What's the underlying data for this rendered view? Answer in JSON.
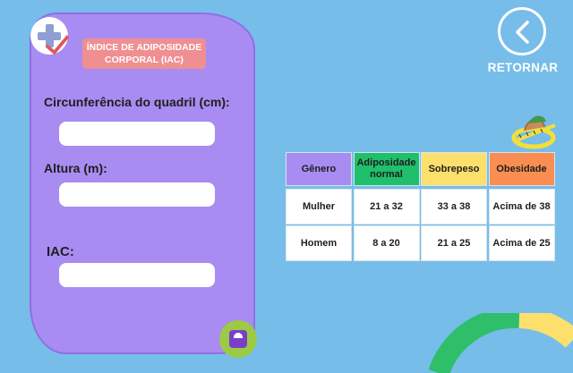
{
  "title_badge": "ÍNDICE DE ADIPOSIDADE CORPORAL (IAC)",
  "form": {
    "hip_label": "Circunferência do quadril (cm):",
    "hip_value": "",
    "height_label": "Altura (m):",
    "height_value": "",
    "iac_label": "IAC:",
    "iac_value": ""
  },
  "nav": {
    "back_label": "RETORNAR"
  },
  "table": {
    "headers": [
      {
        "label": "Gênero",
        "color": "#a98cf1"
      },
      {
        "label": "Adiposidade normal",
        "color": "#1fbf6b"
      },
      {
        "label": "Sobrepeso",
        "color": "#fde06b"
      },
      {
        "label": "Obesidade",
        "color": "#fa8e52"
      }
    ],
    "rows": [
      [
        "Mulher",
        "21 a 32",
        "33 a 38",
        "Acima de 38"
      ],
      [
        "Homem",
        "8 a 20",
        "21 a 25",
        "Acima de 25"
      ]
    ]
  },
  "icons": {
    "logo": "medical-cross-check-icon",
    "scale": "scale-icon",
    "back": "chevron-left-icon",
    "measuring_tape": "measuring-tape-icon"
  },
  "colors": {
    "background": "#77bdea",
    "card": "#a98cf1",
    "badge": "#ef8f92",
    "accent_green": "#9cca45"
  }
}
